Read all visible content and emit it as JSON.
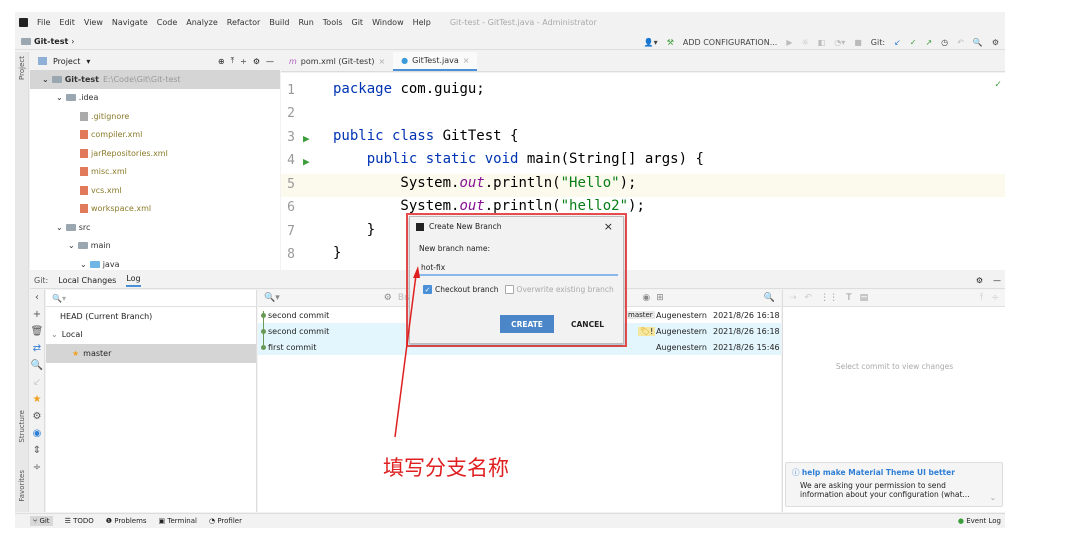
{
  "menu": {
    "items": [
      "File",
      "Edit",
      "View",
      "Navigate",
      "Code",
      "Analyze",
      "Refactor",
      "Build",
      "Run",
      "Tools",
      "Git",
      "Window",
      "Help"
    ],
    "window_title": "Git-test - GitTest.java - Administrator"
  },
  "breadcrumb": {
    "project": "Git-test"
  },
  "toolbar": {
    "add_config": "ADD CONFIGURATION...",
    "git_label": "Git:"
  },
  "project_panel": {
    "title": "Project",
    "side_label": "Project",
    "tree": [
      {
        "label": "Git-test",
        "path": "E:\\Code\\Git\\Git-test",
        "type": "root"
      },
      {
        "label": ".idea",
        "type": "folder"
      },
      {
        "label": ".gitignore",
        "type": "file"
      },
      {
        "label": "compiler.xml",
        "type": "xml"
      },
      {
        "label": "jarRepositories.xml",
        "type": "xml"
      },
      {
        "label": "misc.xml",
        "type": "xml"
      },
      {
        "label": "vcs.xml",
        "type": "xml"
      },
      {
        "label": "workspace.xml",
        "type": "xml"
      },
      {
        "label": "src",
        "type": "folder"
      },
      {
        "label": "main",
        "type": "folder"
      },
      {
        "label": "java",
        "type": "folder-blue"
      }
    ]
  },
  "editor": {
    "tabs": [
      {
        "label": "pom.xml (Git-test)"
      },
      {
        "label": "GitTest.java",
        "active": true
      }
    ],
    "lines": [
      "1",
      "2",
      "3",
      "4",
      "5",
      "6",
      "7",
      "8"
    ]
  },
  "code": {
    "pkg_kw": "package",
    "pkg_name": " com.guigu;",
    "l3a": "public class",
    "l3b": " GitTest {",
    "l4a": "    public static void",
    "l4b": " main(String[] args) {",
    "sys": "        System.",
    "out": "out",
    "println": ".println(",
    "s1": "\"Hello\"",
    "s2": "\"hello2\"",
    "end": ");",
    "close1": "    }",
    "close2": "}"
  },
  "git_panel": {
    "label": "Git:",
    "tabs": [
      "Local Changes",
      "Log"
    ],
    "active_tab": "Log",
    "branches": {
      "head": "HEAD (Current Branch)",
      "local": "Local",
      "master": "master"
    },
    "log_filter_placeholder": "Bra",
    "commits": [
      {
        "message": "second commit",
        "tag": "master",
        "author": "Augenestern",
        "date": "2021/8/26 16:18"
      },
      {
        "message": "second commit",
        "tag": "!",
        "author": "Augenestern",
        "date": "2021/8/26 16:18"
      },
      {
        "message": "first commit",
        "author": "Augenestern",
        "date": "2021/8/26 15:46"
      }
    ],
    "details_empty": "Select commit to view changes"
  },
  "notification": {
    "title": "help make Material Theme UI better",
    "body1": "We are asking your permission to send",
    "body2": "information about your configuration (what..."
  },
  "side_labels": {
    "structure": "Structure",
    "favorites": "Favorites"
  },
  "status_bar": {
    "items": [
      "Git",
      "TODO",
      "Problems",
      "Terminal",
      "Profiler"
    ],
    "event_log": "Event Log"
  },
  "dialog": {
    "title": "Create New Branch",
    "label": "New branch name:",
    "value": "hot-fix",
    "checkout": "Checkout branch",
    "checkout_checked": true,
    "overwrite": "Overwrite existing branch",
    "overwrite_checked": false,
    "create": "CREATE",
    "cancel": "CANCEL"
  },
  "annotation": {
    "text": "填写分支名称",
    "color": "#e02020"
  },
  "colors": {
    "accent": "#4a90d9",
    "create_button": "#4a86c8"
  }
}
